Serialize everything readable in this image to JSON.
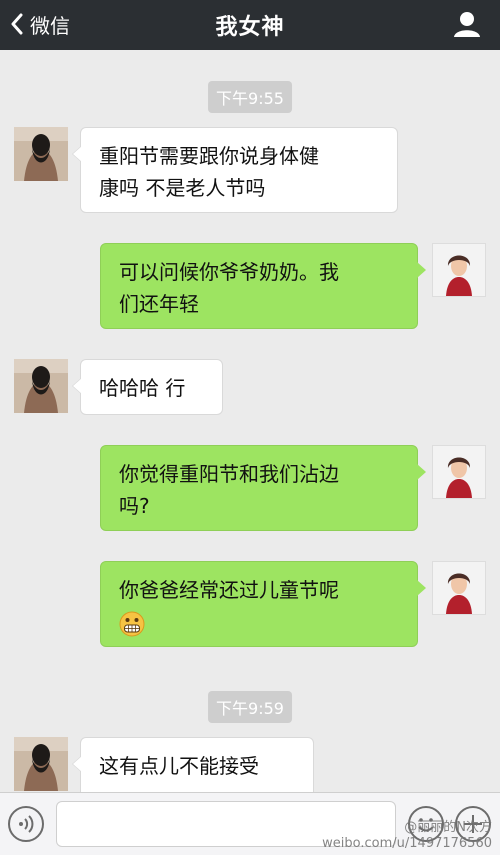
{
  "titlebar": {
    "back_label": "微信",
    "title": "我女神",
    "icons": {
      "back": "chevron-left-icon",
      "contact": "person-icon"
    }
  },
  "messages": [
    {
      "type": "time",
      "text": "下午9:55"
    },
    {
      "type": "msg",
      "side": "left",
      "sender": "我女神",
      "lines": [
        "重阳节需要跟你说身体健",
        "康吗 不是老人节吗"
      ]
    },
    {
      "type": "msg",
      "side": "right",
      "sender": "me",
      "lines": [
        "可以问候你爷爷奶奶。我",
        "们还年轻"
      ]
    },
    {
      "type": "msg",
      "side": "left",
      "sender": "我女神",
      "lines": [
        "哈哈哈 行"
      ]
    },
    {
      "type": "msg",
      "side": "right",
      "sender": "me",
      "lines": [
        "你觉得重阳节和我们沾边",
        "吗?"
      ]
    },
    {
      "type": "msg",
      "side": "right",
      "sender": "me",
      "lines": [
        "你爸爸经常还过儿童节呢"
      ],
      "emoji": "grimacing-face-emoji"
    },
    {
      "type": "time",
      "text": "下午9:59"
    },
    {
      "type": "msg",
      "side": "left",
      "sender": "我女神",
      "lines": [
        "这有点儿不能接受"
      ]
    }
  ],
  "inputbar": {
    "icons": {
      "voice": "voice-icon",
      "emoji": "emoji-smile-icon",
      "more": "plus-icon"
    },
    "text_value": ""
  },
  "watermark": {
    "line1": "@丽丽的N次方",
    "line2": "weibo.com/u/1497176560"
  },
  "colors": {
    "titlebar": "#2b2f33",
    "chat_bg": "#ebebeb",
    "my_bubble": "#9de461",
    "their_bubble": "#ffffff",
    "time_badge": "#cecece"
  }
}
